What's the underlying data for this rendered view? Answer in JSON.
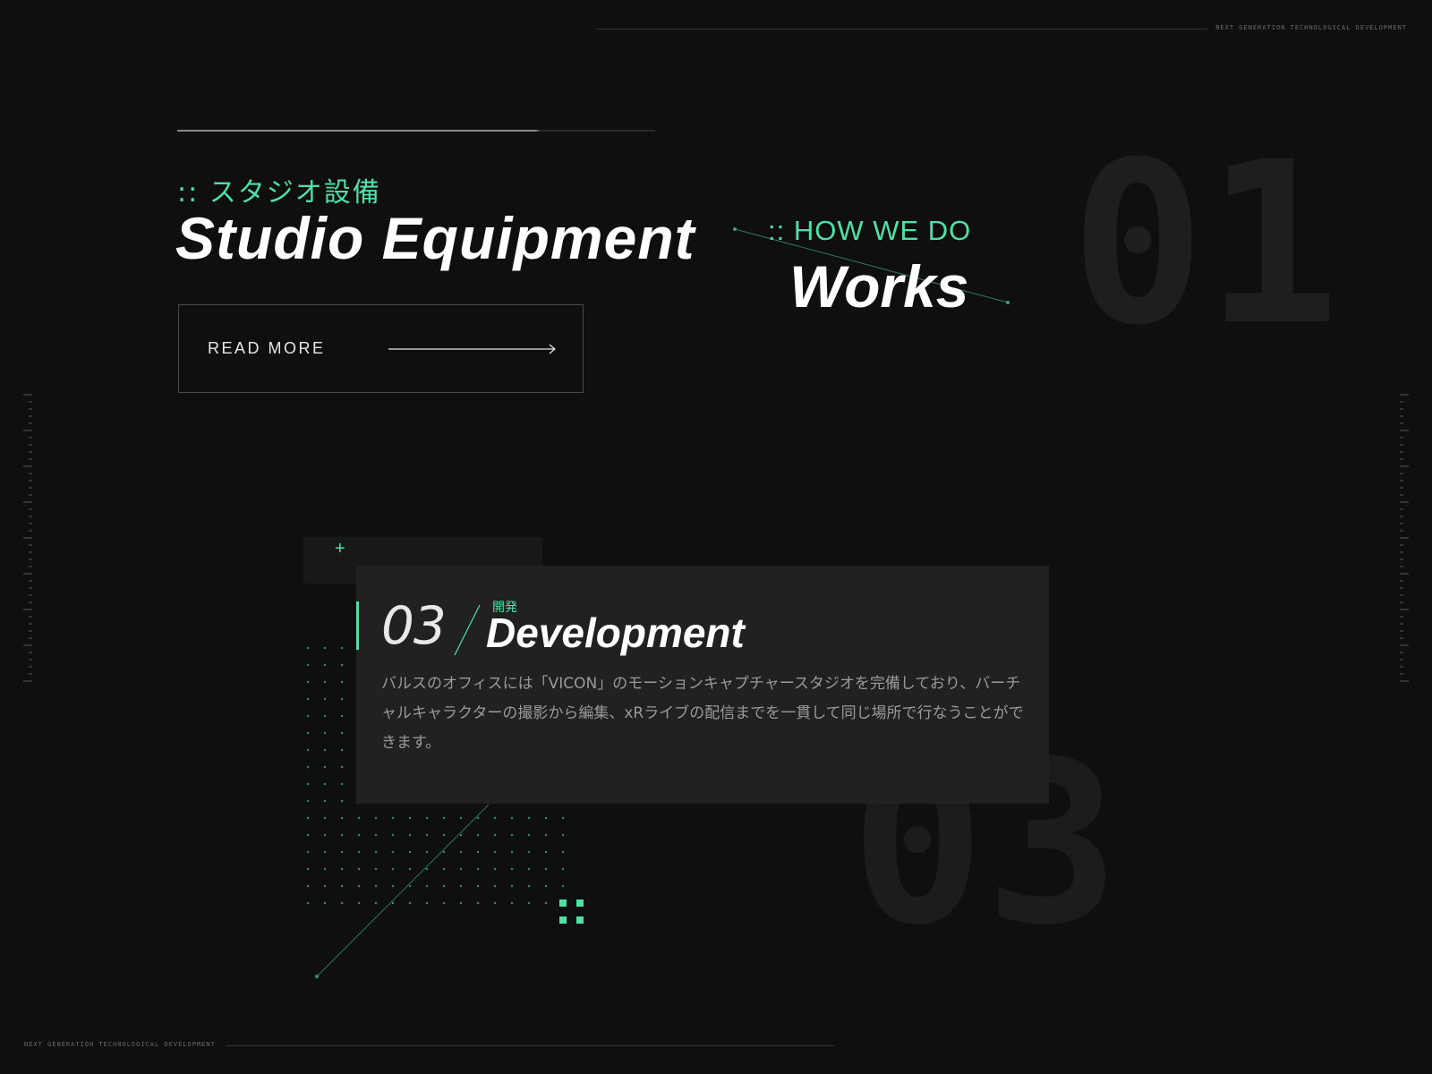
{
  "taglines": {
    "top": "NEXT GENERATION TECHNOLOGICAL DEVELOPMENT",
    "bottom": "NEXT GENERATION TECHNOLOGICAL DEVELOPMENT"
  },
  "studio": {
    "jp_heading": ":: スタジオ設備",
    "heading": "Studio Equipment",
    "read_more_label": "READ MORE"
  },
  "how_we_do": {
    "label": ":: HOW WE DO",
    "heading": "Works"
  },
  "big_numbers": {
    "first": "01",
    "second": "03"
  },
  "card": {
    "number": "03",
    "jp_label": "開発",
    "title": "Development",
    "body": "バルスのオフィスには「VICON」のモーションキャプチャースタジオを完備しており、バーチャルキャラクターの撮影から編集、xRライブの配信までを一貫して同じ場所で行なうことができます。"
  },
  "colors": {
    "background": "#0f0f0f",
    "accent": "#4fe0a8",
    "card": "#212121"
  },
  "icons": [
    "plus-icon",
    "arrow-right-icon"
  ]
}
